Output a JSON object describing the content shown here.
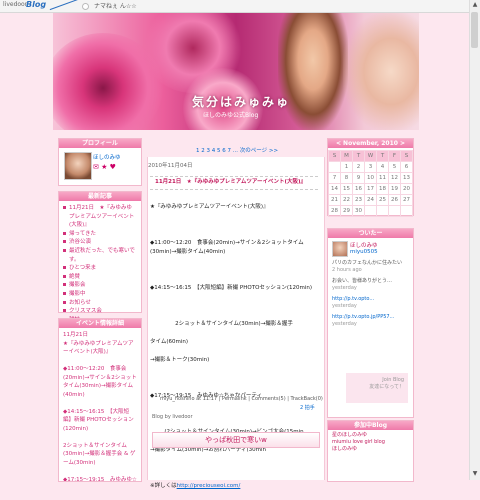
{
  "topbar": {
    "brand": "livedoor",
    "logo": "Blog",
    "site": "ナマねぇ ん☆☆"
  },
  "header": {
    "title": "気分はみゅみゅ",
    "subtitle": "ほしのみゆ公式Blog"
  },
  "profile": {
    "heading": "プロフィール",
    "name": "ほしのみゆ"
  },
  "recent": {
    "heading": "最新記事",
    "items": [
      "11月21日　★『みゆみゆプレミアムツアーイベント(大阪)』",
      "帰ってきた",
      "渋谷公演",
      "最近秋だった、でも寒いです。",
      "ひとつ来ま",
      "絶賛",
      "撮影会",
      "撮影中",
      "お知らせ",
      "クリスマス会",
      "雑誌"
    ]
  },
  "event": {
    "heading": "イベント情報詳細",
    "text": "11月21日\n★『みゆみゆプレミアムツアーイベント(大阪)』\n\n◆11:00〜12:20　食事会(20min)→サイン＆2ショットタイム(30min)→撮影タイム(40min)\n\n◆14:15〜16:15　【大阪短編】新撮 PHOTOセッション(120min)\n\n2ショット＆サインタイム(30min)→撮影＆握手会 & ゲーム(30min)\n\n◆17:15〜19:15　みゆみゆ☆ちゃかパーティ"
  },
  "pager": {
    "text": "1 2 3 4 5 6 7 ... 次のページ >>"
  },
  "post": {
    "date": "2010年11月04日",
    "title": "11月21日　★『みゆみゆプレミアムツアーイベント(大阪)』",
    "body1": "★『みゆみゆプレミアムツアーイベント(大阪)』",
    "body2": "◆11:00〜12:20　食事会(20min)→サイン＆2ショットタイム(30min)→撮影タイム(40min)",
    "body3": "◆14:15〜16:15　【大阪短編】新撮 PHOTOセッション(120min)",
    "body4": "2ショット＆サインタイム(30min)→撮影＆握手",
    "body5": "タイム(60min)",
    "body6": "→撮影＆トーク(30min)",
    "body7": "◆17:15〜19:15　みゆみゆ☆ちゃかパーティ",
    "body8": "(2ショット＆サインタイム(30min)→ビンゴ大会(15min",
    "body9": "→撮影タイム(30min)→お別れパーティ(30min",
    "more_prefix": "※詳しくは",
    "link": "http://preciouseoi.com/"
  },
  "footer": {
    "meta": "miyu_hoshino at 11:17 | Permalink | Comments(5) | TrackBack(0)",
    "count": "2 拍手"
  },
  "byline": "Blog by livedoor",
  "nextpost": {
    "title": "やっぱ秋田で寒いw"
  },
  "calendar": {
    "heading": "< November, 2010 >",
    "days": [
      "S",
      "M",
      "T",
      "W",
      "T",
      "F",
      "S"
    ],
    "weeks": [
      [
        "",
        "1",
        "2",
        "3",
        "4",
        "5",
        "6"
      ],
      [
        "7",
        "8",
        "9",
        "10",
        "11",
        "12",
        "13"
      ],
      [
        "14",
        "15",
        "16",
        "17",
        "18",
        "19",
        "20"
      ],
      [
        "21",
        "22",
        "23",
        "24",
        "25",
        "26",
        "27"
      ],
      [
        "28",
        "29",
        "30",
        "",
        "",
        "",
        ""
      ]
    ]
  },
  "twitter": {
    "heading": "ついたー",
    "name": "ほしのみゆ",
    "handle": "miyu0505",
    "items": [
      "パリのカフェなんかに住みたい",
      "2 hours ago",
      "お会い、皆様ありがとう…",
      "yesterday",
      "http://p.tv.opto...",
      "yesterday",
      "http://p.tv.opto.jp/PP57...",
      "yesterday"
    ],
    "mini": "Join Blog\n友達になって！"
  },
  "other": {
    "heading": "参加中Blog",
    "items": [
      "星のほしのみゆ",
      "miumiu love girl blog",
      "ほしのみゆ"
    ]
  }
}
